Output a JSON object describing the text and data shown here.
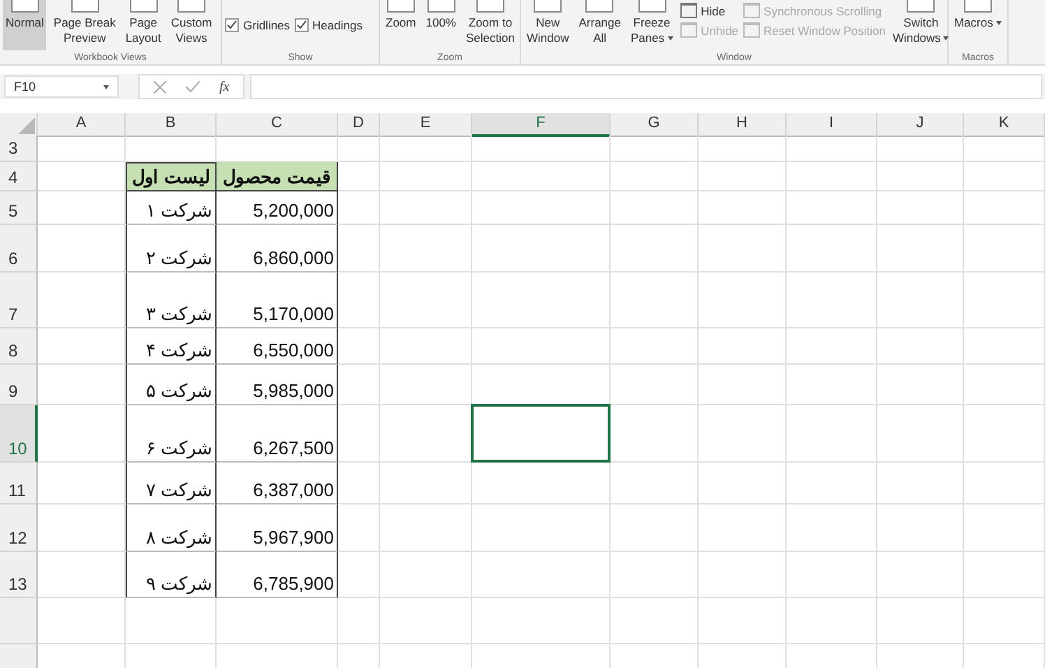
{
  "ribbon": {
    "groups": [
      {
        "label": "Workbook Views",
        "items": [
          {
            "kind": "large",
            "lines": [
              "Normal"
            ],
            "selected": true,
            "dropdown": false
          },
          {
            "kind": "large",
            "lines": [
              "Page Break",
              "Preview"
            ],
            "selected": false,
            "dropdown": false
          },
          {
            "kind": "large",
            "lines": [
              "Page",
              "Layout"
            ],
            "selected": false,
            "dropdown": false
          },
          {
            "kind": "large",
            "lines": [
              "Custom",
              "Views"
            ],
            "selected": false,
            "dropdown": false
          }
        ]
      },
      {
        "label": "Show",
        "items": [
          {
            "kind": "check",
            "label": "Gridlines",
            "checked": true
          },
          {
            "kind": "check",
            "label": "Headings",
            "checked": true
          }
        ]
      },
      {
        "label": "Zoom",
        "items": [
          {
            "kind": "large",
            "lines": [
              "Zoom"
            ],
            "selected": false,
            "dropdown": false
          },
          {
            "kind": "large",
            "lines": [
              "100%"
            ],
            "selected": false,
            "dropdown": false
          },
          {
            "kind": "large",
            "lines": [
              "Zoom to",
              "Selection"
            ],
            "selected": false,
            "dropdown": false
          }
        ]
      },
      {
        "label": "Window",
        "items": [
          {
            "kind": "large",
            "lines": [
              "New",
              "Window"
            ],
            "selected": false,
            "dropdown": false
          },
          {
            "kind": "large",
            "lines": [
              "Arrange",
              "All"
            ],
            "selected": false,
            "dropdown": false
          },
          {
            "kind": "large",
            "lines": [
              "Freeze",
              "Panes"
            ],
            "selected": false,
            "dropdown": true
          },
          {
            "kind": "stack",
            "items": [
              {
                "label": "Hide",
                "disabled": false
              },
              {
                "label": "Unhide",
                "disabled": true
              }
            ]
          },
          {
            "kind": "stack",
            "items": [
              {
                "label": "Synchronous Scrolling",
                "disabled": true
              },
              {
                "label": "Reset Window Position",
                "disabled": true
              }
            ]
          },
          {
            "kind": "large",
            "lines": [
              "Switch",
              "Windows"
            ],
            "selected": false,
            "dropdown": true
          }
        ]
      },
      {
        "label": "Macros",
        "items": [
          {
            "kind": "large",
            "lines": [
              "Macros"
            ],
            "selected": false,
            "dropdown": true
          }
        ]
      }
    ]
  },
  "formula_bar": {
    "name_box": "F10",
    "function_label": "fx"
  },
  "sheet": {
    "columns": [
      {
        "label": "A",
        "selected": false
      },
      {
        "label": "B",
        "selected": false
      },
      {
        "label": "C",
        "selected": false
      },
      {
        "label": "D",
        "selected": false
      },
      {
        "label": "E",
        "selected": false
      },
      {
        "label": "F",
        "selected": true
      },
      {
        "label": "G",
        "selected": false
      },
      {
        "label": "H",
        "selected": false
      },
      {
        "label": "I",
        "selected": false
      },
      {
        "label": "J",
        "selected": false
      },
      {
        "label": "K",
        "selected": false
      }
    ],
    "rows": [
      {
        "number": "3",
        "selected": false,
        "kind": "empty"
      },
      {
        "number": "4",
        "selected": false,
        "kind": "header",
        "b": "لیست اول",
        "c": "قیمت محصول"
      },
      {
        "number": "5",
        "selected": false,
        "kind": "data",
        "b": "شرکت ۱",
        "c": "5,200,000"
      },
      {
        "number": "6",
        "selected": false,
        "kind": "data",
        "b": "شرکت ۲",
        "c": "6,860,000"
      },
      {
        "number": "7",
        "selected": false,
        "kind": "data",
        "b": "شرکت ۳",
        "c": "5,170,000"
      },
      {
        "number": "8",
        "selected": false,
        "kind": "data",
        "b": "شرکت ۴",
        "c": "6,550,000"
      },
      {
        "number": "9",
        "selected": false,
        "kind": "data",
        "b": "شرکت ۵",
        "c": "5,985,000"
      },
      {
        "number": "10",
        "selected": true,
        "kind": "data",
        "b": "شرکت ۶",
        "c": "6,267,500"
      },
      {
        "number": "11",
        "selected": false,
        "kind": "data",
        "b": "شرکت ۷",
        "c": "6,387,000"
      },
      {
        "number": "12",
        "selected": false,
        "kind": "data",
        "b": "شرکت ۸",
        "c": "5,967,900"
      },
      {
        "number": "13",
        "selected": false,
        "kind": "data",
        "b": "شرکت ۹",
        "c": "6,785,900"
      }
    ]
  }
}
